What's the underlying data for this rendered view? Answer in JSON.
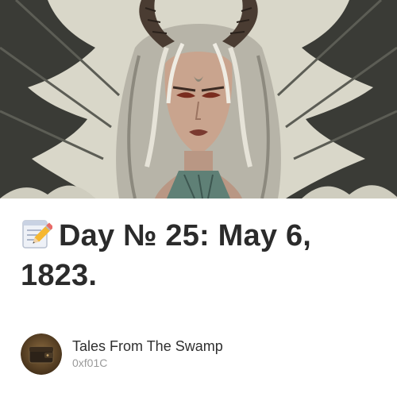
{
  "hero": {
    "image_subject": "horned-winged-woman-illustration"
  },
  "post": {
    "title_icon": "memo-pencil-icon",
    "title": "Day № 25: May 6, 1823."
  },
  "author": {
    "name": "Tales From The Swamp",
    "handle": "0xf01C",
    "avatar_icon": "wallet-icon"
  },
  "colors": {
    "title_text": "#2b2b2b",
    "name_text": "#2f2f2f",
    "handle_text": "#9a9a9a",
    "background": "#ffffff"
  }
}
